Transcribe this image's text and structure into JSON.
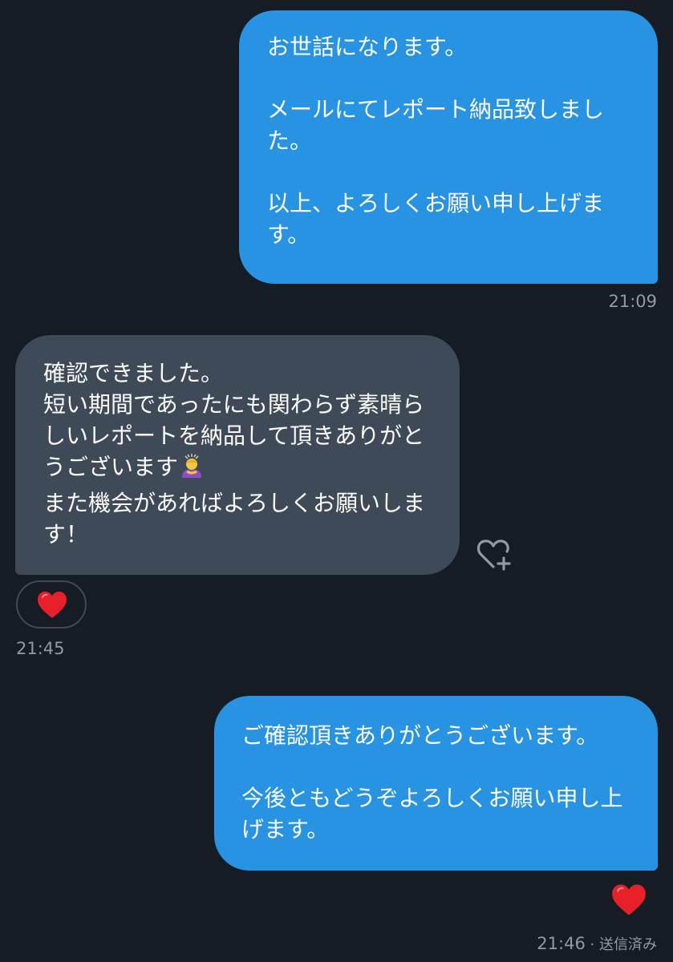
{
  "conversation": {
    "messages": [
      {
        "direction": "sent",
        "text": "お世話になります。\n\nメールにてレポート納品致しました。\n\n以上、よろしくお願い申し上げます。",
        "time": "21:09"
      },
      {
        "direction": "received",
        "text_before_emoji": "確認できました。\n短い期間であったにも関わらず素晴らしいレポートを納品して頂きありがとうございます",
        "emoji": "bowing-person-emoji",
        "text_after_emoji": "\nまた機会があればよろしくお願いします！",
        "time": "21:45",
        "reaction": "heart-emoji",
        "add_reaction_icon": "heart-plus-icon"
      },
      {
        "direction": "sent",
        "text": "ご確認頂きありがとうございます。\n\n今後ともどうぞよろしくお願い申し上げます。",
        "time": "21:46",
        "status": "送信済み",
        "reaction": "heart-emoji"
      }
    ]
  },
  "colors": {
    "background": "#151c24",
    "sent_bubble": "#2793e2",
    "received_bubble": "#3e4a58",
    "timestamp": "#8f9aa6",
    "heart": "#e8202a"
  }
}
